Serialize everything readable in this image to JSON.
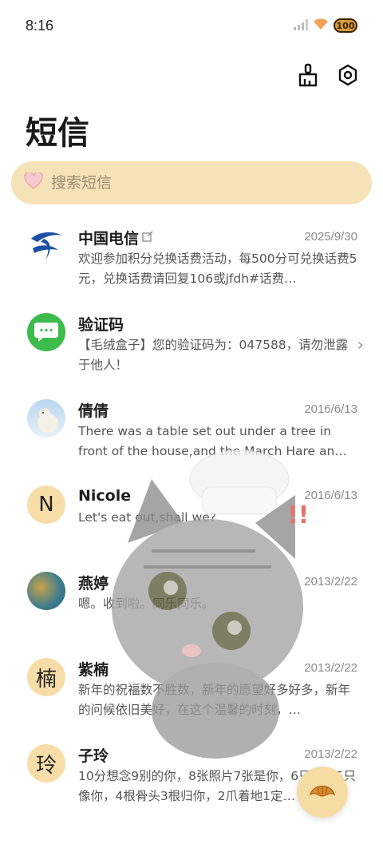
{
  "status": {
    "time": "8:16",
    "battery": "100"
  },
  "toolbar": {
    "clean_icon": "broom-icon",
    "settings_icon": "gear-icon"
  },
  "title": "短信",
  "search": {
    "placeholder": "搜索短信"
  },
  "messages": [
    {
      "name": "中国电信",
      "date": "2025/9/30",
      "snippet": "欢迎参加积分兑换话费活动，每500分可兑换话费5元，兑换话费请回复106或jfdh#话费…",
      "avatar": "china-telecom-logo"
    },
    {
      "name": "验证码",
      "date": "",
      "snippet": "【毛绒盒子】您的验证码为：047588，请勿泄露于他人！",
      "avatar": "sms-bubble-icon"
    },
    {
      "name": "倩倩",
      "date": "2016/6/13",
      "snippet": "There was a table set out under a tree in front of the house,and the March Hare an…",
      "avatar": "polar-bear-photo"
    },
    {
      "name": "Nicole",
      "date": "2016/6/13",
      "snippet": "Let's eat out,shall we?",
      "avatar_letter": "N"
    },
    {
      "name": "燕婷",
      "date": "2013/2/22",
      "snippet": "嗯。收到啦。同乐同乐。",
      "avatar": "landscape-photo"
    },
    {
      "name": "紫楠",
      "date": "2013/2/22",
      "snippet": "新年的祝福数不胜数，新年的愿望好多好多，新年的问候依旧美好，在这个温馨的时刻，…",
      "avatar_letter": "楠"
    },
    {
      "name": "子玲",
      "date": "2013/2/22",
      "snippet": "10分想念9别的你，8张照片7张是你，6只小狗5只像你，4根骨头3根归你，2爪着地1定…",
      "avatar_letter": "玲"
    }
  ],
  "fab_icon": "croissant-icon"
}
